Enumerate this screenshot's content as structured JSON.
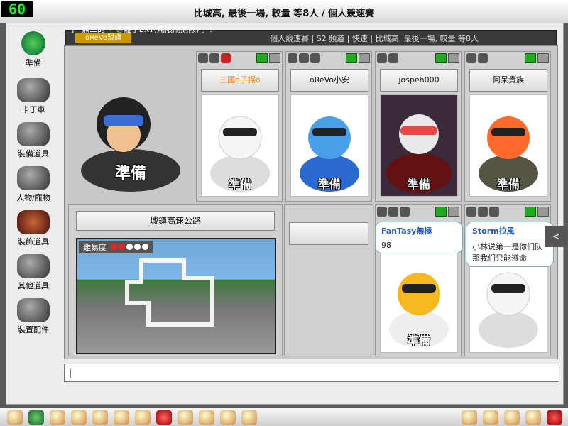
{
  "fps": "60",
  "title": "比城高, 最後一場, 較量  等8人  /  個人競速賽",
  "ticker": "]一無二的「 等離子EXT(無限制期限) 」!",
  "room": {
    "name": "oReVo盟旗",
    "info": "個人競速賽  |  S2 頻道  |  快速  |  比城高, 最後一場, 較量  等8人"
  },
  "sidebar": [
    {
      "label": "準備",
      "icon": "ready-icon"
    },
    {
      "label": "卡丁車",
      "icon": "kart-icon"
    },
    {
      "label": "裝備道具",
      "icon": "equipment-icon"
    },
    {
      "label": "人物/寵物",
      "icon": "character-icon"
    },
    {
      "label": "裝飾道具",
      "icon": "decoration-icon"
    },
    {
      "label": "其他道具",
      "icon": "items-icon"
    },
    {
      "label": "裝置配件",
      "icon": "parts-icon"
    }
  ],
  "self_ready": "準備",
  "players": [
    {
      "name": "三國o子揚o",
      "ready": "準備",
      "color": "#ff8800"
    },
    {
      "name": "oReVo小安",
      "ready": "準備",
      "color": "#111111"
    },
    {
      "name": "jospeh000",
      "ready": "準備",
      "color": "#111111"
    },
    {
      "name": "阿呆貴族",
      "ready": "準備",
      "color": "#111111"
    }
  ],
  "bottom_players": [
    {
      "ready": "準備",
      "chat_name": "FanTasy無極",
      "chat_text": "98"
    },
    {
      "ready": "",
      "chat_name": "Storm拉風",
      "chat_text": "小林说第一是你们队 那我们只能遵命"
    }
  ],
  "track": {
    "name": "城鎮高速公路",
    "difficulty_label": "難易度"
  },
  "chat_input": "|",
  "side_tab": "<"
}
